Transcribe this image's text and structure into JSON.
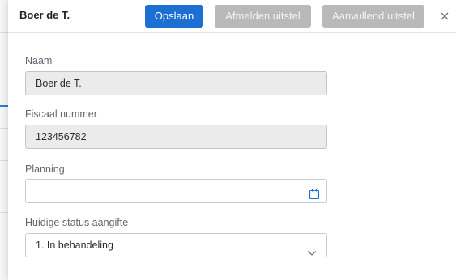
{
  "header": {
    "title": "Boer de T.",
    "save_label": "Opslaan",
    "cancel_deferral_label": "Afmelden uitstel",
    "additional_deferral_label": "Aanvullend uitstel",
    "close_icon": "close-icon"
  },
  "form": {
    "name": {
      "label": "Naam",
      "value": "Boer de T."
    },
    "tax_number": {
      "label": "Fiscaal nummer",
      "value": "123456782"
    },
    "planning": {
      "label": "Planning",
      "value": "",
      "icon": "calendar-icon"
    },
    "status": {
      "label": "Huidige status aangifte",
      "value": "1. In behandeling",
      "icon": "chevron-down-icon"
    }
  },
  "colors": {
    "primary": "#1d6fd1",
    "disabled": "#b9b9b9",
    "readonly_bg": "#ebebeb"
  }
}
